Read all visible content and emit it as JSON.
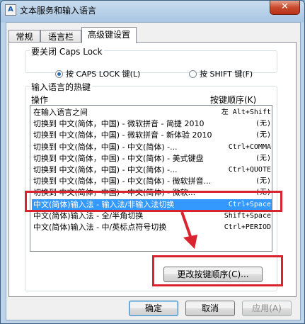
{
  "window": {
    "title": "文本服务和输入语言",
    "close_label": "✕",
    "icon_glyph": "A"
  },
  "tabs": [
    {
      "label": "常规"
    },
    {
      "label": "语言栏"
    },
    {
      "label": "高级键设置"
    }
  ],
  "caps_lock_group": {
    "label": "要关闭 Caps Lock",
    "option1": "按 CAPS LOCK 键(L)",
    "option2": "按 SHIFT 键(F)",
    "selected": 1
  },
  "hotkeys_group": {
    "label": "输入语言的热键",
    "col_action": "操作",
    "col_keys": "按键顺序(K)",
    "rows": [
      {
        "action": "在输入语言之间",
        "keys": "左 Alt+Shift"
      },
      {
        "action": "切换到 中文(简体，中国) - 微软拼音 - 简捷 2010",
        "keys": "(无)"
      },
      {
        "action": "切换到 中文(简体，中国) - 微软拼音 - 新体验 2010",
        "keys": "(无)"
      },
      {
        "action": "切换到 中文(简体，中国) - 中文(简体) -...",
        "keys": "Ctrl+COMMA"
      },
      {
        "action": "切换到 中文(简体，中国) - 中文(简体) - 美式键盘",
        "keys": "(无)"
      },
      {
        "action": "切换到 中文(简体，中国) - 中文(简体) -...",
        "keys": "Ctrl+QUOTE"
      },
      {
        "action": "切换到 中文(简体，中国) - 中文(简体) - 微软拼音...",
        "keys": "(无)"
      },
      {
        "action": "切换到 中文(简体，中国) - 中文(简体) - 微软...",
        "keys": "(无)"
      },
      {
        "action": "中文(简体)输入法 - 输入法/非输入法切换",
        "keys": "Ctrl+Space"
      },
      {
        "action": "中文(简体)输入法 - 全/半角切换",
        "keys": "Shift+Space"
      },
      {
        "action": "中文(简体)输入法 - 中/英标点符号切换",
        "keys": "Ctrl+PERIOD"
      }
    ],
    "selected_index": 8,
    "change_button": "更改按键顺序(C)..."
  },
  "footer": {
    "ok": "确定",
    "cancel": "取消",
    "apply": "应用(A)"
  },
  "colors": {
    "selection": "#3399ff",
    "annotation": "#d9232e"
  }
}
